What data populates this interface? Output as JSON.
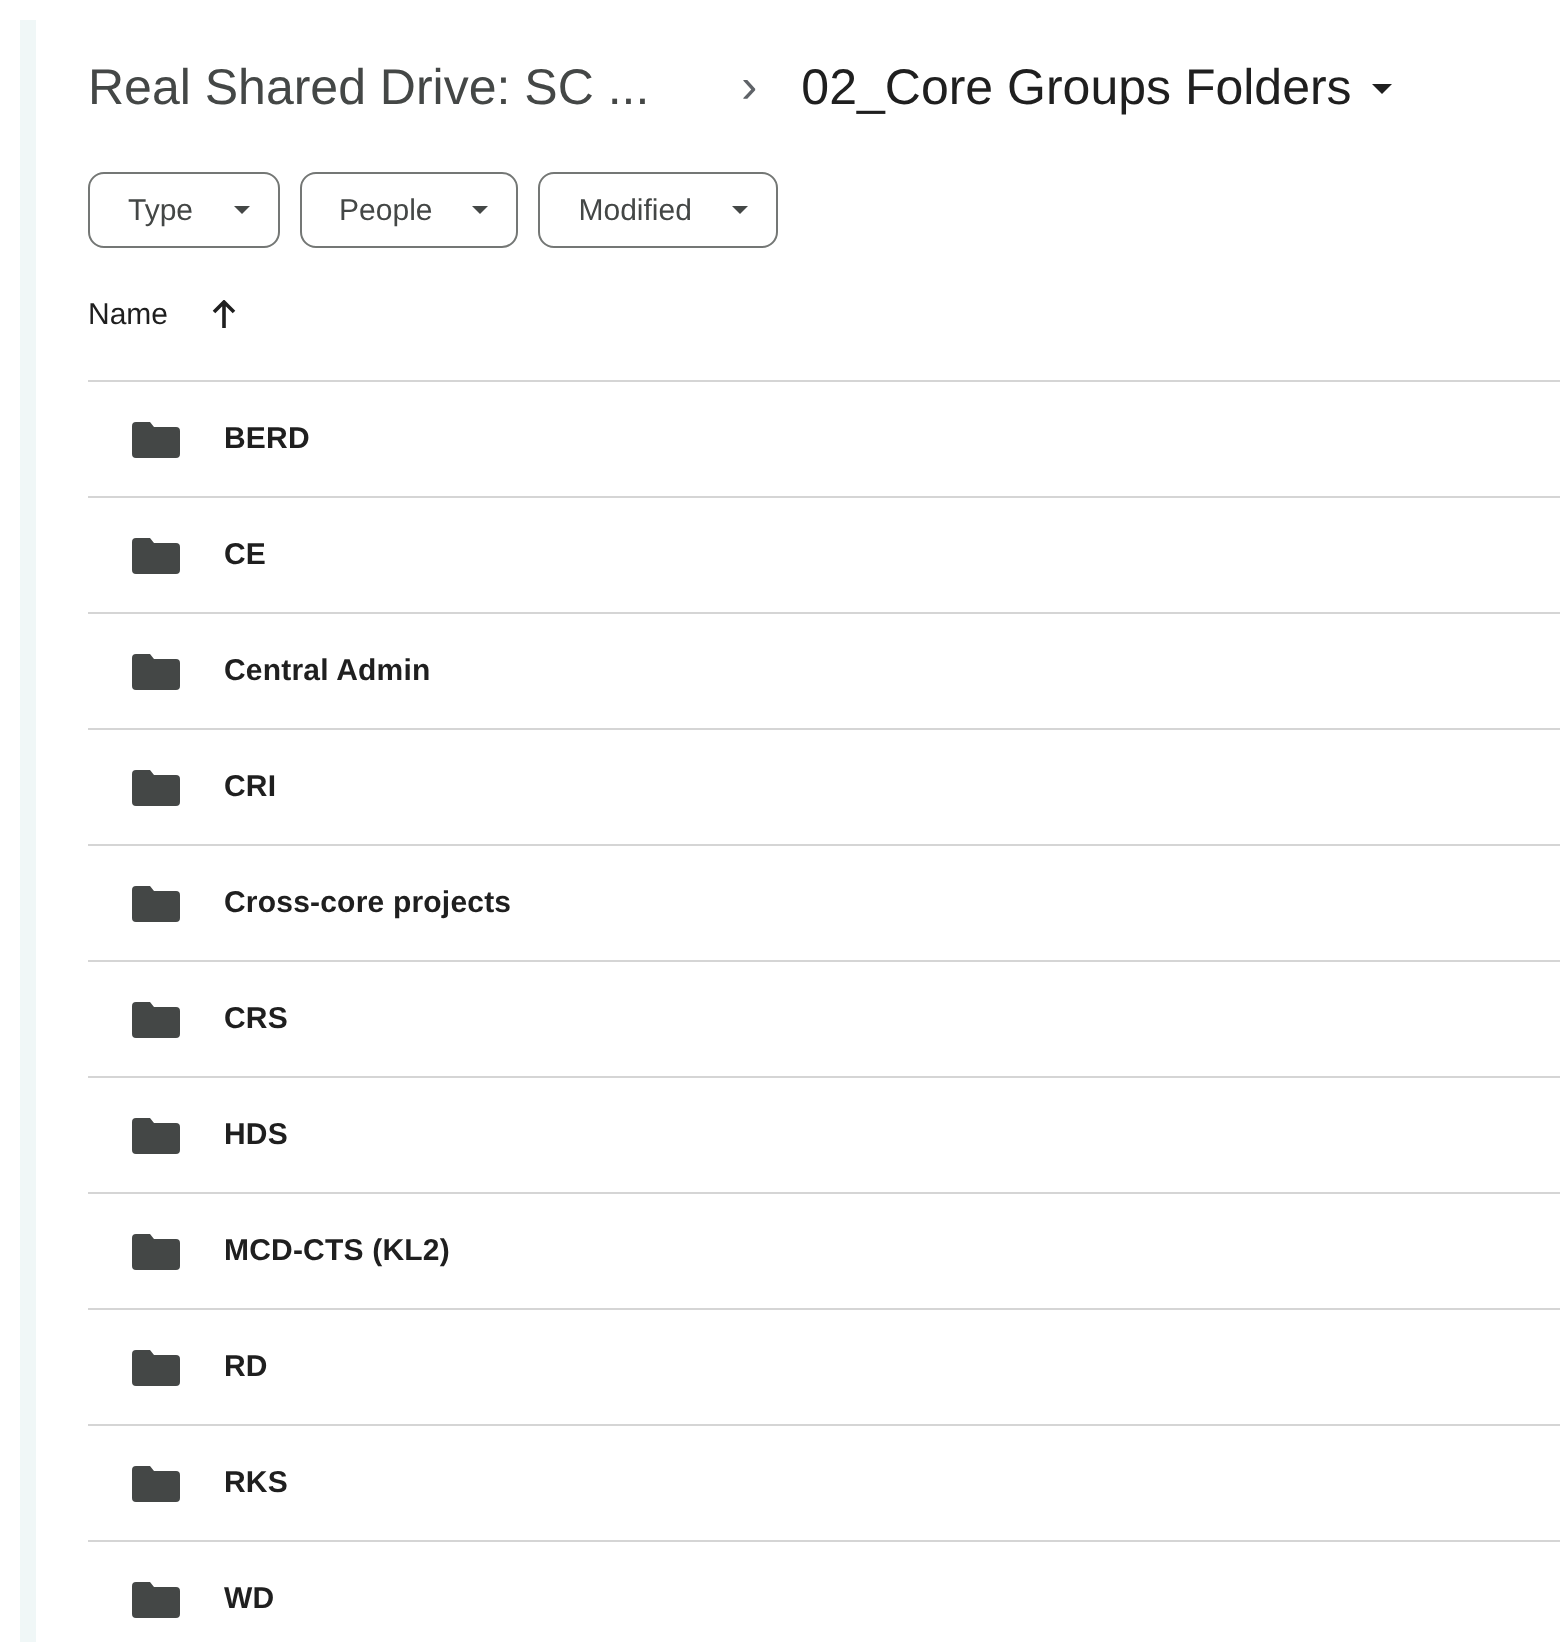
{
  "breadcrumb": {
    "parent": "Real Shared Drive: SC ...",
    "separator": "›",
    "current": "02_Core Groups Folders"
  },
  "filters": [
    {
      "label": "Type"
    },
    {
      "label": "People"
    },
    {
      "label": "Modified"
    }
  ],
  "table": {
    "columns": [
      {
        "label": "Name",
        "sorted_ascending": true
      }
    ],
    "rows": [
      {
        "name": "BERD",
        "kind": "folder"
      },
      {
        "name": "CE",
        "kind": "folder"
      },
      {
        "name": "Central Admin",
        "kind": "folder"
      },
      {
        "name": "CRI",
        "kind": "folder"
      },
      {
        "name": "Cross-core projects",
        "kind": "folder"
      },
      {
        "name": "CRS",
        "kind": "folder"
      },
      {
        "name": "HDS",
        "kind": "folder"
      },
      {
        "name": "MCD-CTS (KL2)",
        "kind": "folder"
      },
      {
        "name": "RD",
        "kind": "folder"
      },
      {
        "name": "RKS",
        "kind": "folder"
      },
      {
        "name": "WD",
        "kind": "folder"
      }
    ]
  }
}
